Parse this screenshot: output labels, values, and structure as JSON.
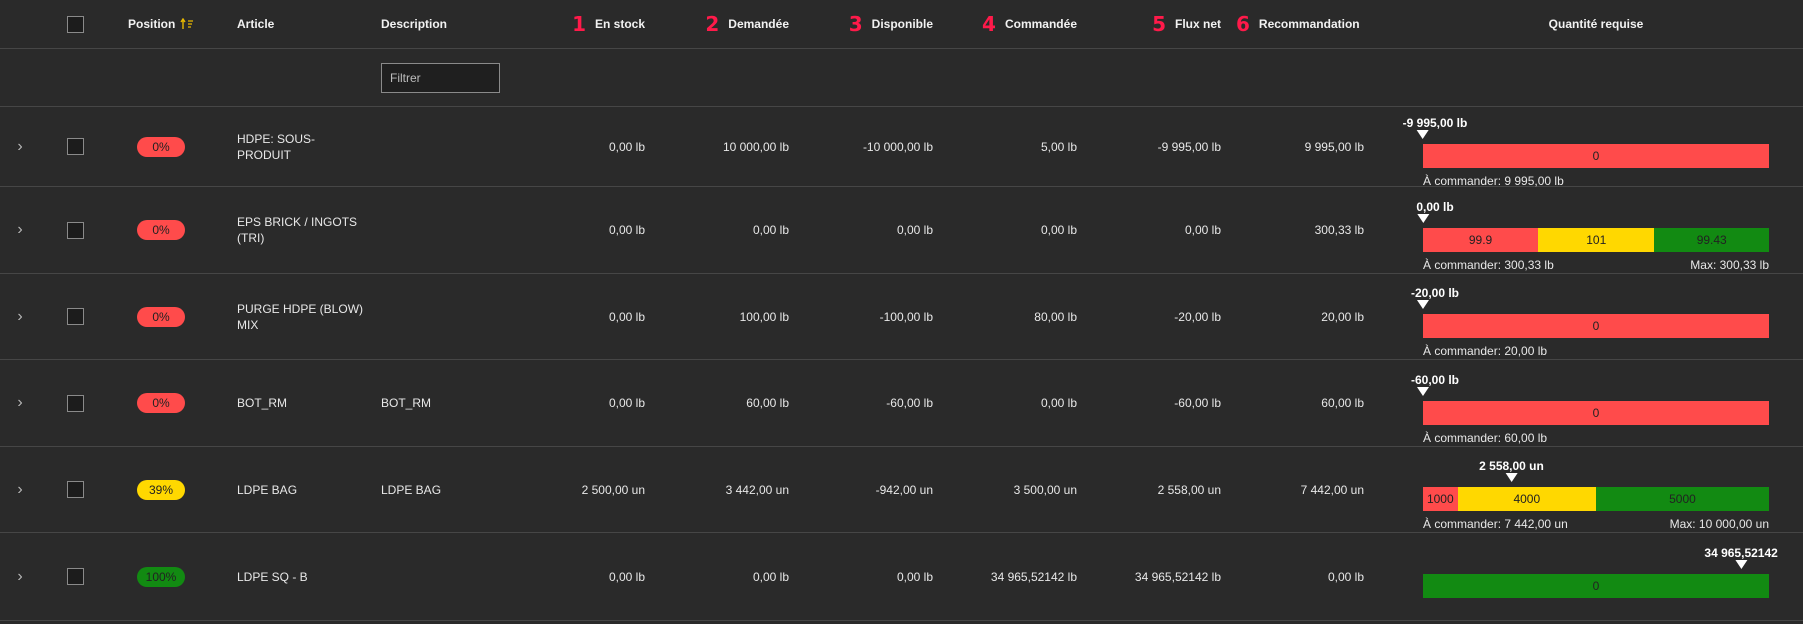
{
  "colors": {
    "red": "#ff4b4b",
    "yellow": "#ffd800",
    "green": "#128a12",
    "highlight_number": "#ff1a4a",
    "sort_icon": "#e8b800"
  },
  "header": {
    "position": "Position",
    "article": "Article",
    "description": "Description",
    "en_stock_num": "1",
    "en_stock": "En stock",
    "demandee_num": "2",
    "demandee": "Demandée",
    "disponible_num": "3",
    "disponible": "Disponible",
    "commandee_num": "4",
    "commandee": "Commandée",
    "flux_net_num": "5",
    "flux_net": "Flux net",
    "recommandation_num": "6",
    "recommandation": "Recommandation",
    "quantite_requise": "Quantité requise"
  },
  "filter": {
    "placeholder": "Filtrer"
  },
  "rows": [
    {
      "position": "0%",
      "position_value": 0,
      "badge_color": "#ff4b4b",
      "article": "HDPE: SOUS-PRODUIT",
      "description": "",
      "en_stock": "0,00 lb",
      "demandee": "10 000,00 lb",
      "disponible": "-10 000,00 lb",
      "commandee": "5,00 lb",
      "flux_net": "-9 995,00 lb",
      "recommandation": "9 995,00 lb",
      "marker_label": "-9 995,00 lb",
      "marker_fraction": 0,
      "segments": [
        {
          "label": "0",
          "color": "#ff4b4b",
          "fraction": 1
        }
      ],
      "to_order": "À commander: 9 995,00 lb",
      "max": ""
    },
    {
      "position": "0%",
      "position_value": 0,
      "badge_color": "#ff4b4b",
      "article": "EPS BRICK / INGOTS (TRI)",
      "description": "",
      "en_stock": "0,00 lb",
      "demandee": "0,00 lb",
      "disponible": "0,00 lb",
      "commandee": "0,00 lb",
      "flux_net": "0,00 lb",
      "recommandation": "300,33 lb",
      "marker_label": "0,00 lb",
      "marker_fraction": 0,
      "segments": [
        {
          "label": "99.9",
          "color": "#ff4b4b",
          "fraction": 0.3326
        },
        {
          "label": "101",
          "color": "#ffd800",
          "fraction": 0.3363
        },
        {
          "label": "99.43",
          "color": "#128a12",
          "fraction": 0.3311
        }
      ],
      "to_order": "À commander: 300,33 lb",
      "max": "Max: 300,33 lb"
    },
    {
      "position": "0%",
      "position_value": 0,
      "badge_color": "#ff4b4b",
      "article": "PURGE HDPE (BLOW) MIX",
      "description": "",
      "en_stock": "0,00 lb",
      "demandee": "100,00 lb",
      "disponible": "-100,00 lb",
      "commandee": "80,00 lb",
      "flux_net": "-20,00 lb",
      "recommandation": "20,00 lb",
      "marker_label": "-20,00 lb",
      "marker_fraction": 0,
      "segments": [
        {
          "label": "0",
          "color": "#ff4b4b",
          "fraction": 1
        }
      ],
      "to_order": "À commander: 20,00 lb",
      "max": ""
    },
    {
      "position": "0%",
      "position_value": 0,
      "badge_color": "#ff4b4b",
      "article": "BOT_RM",
      "description": "BOT_RM",
      "en_stock": "0,00 lb",
      "demandee": "60,00 lb",
      "disponible": "-60,00 lb",
      "commandee": "0,00 lb",
      "flux_net": "-60,00 lb",
      "recommandation": "60,00 lb",
      "marker_label": "-60,00 lb",
      "marker_fraction": 0,
      "segments": [
        {
          "label": "0",
          "color": "#ff4b4b",
          "fraction": 1
        }
      ],
      "to_order": "À commander: 60,00 lb",
      "max": ""
    },
    {
      "position": "39%",
      "position_value": 39,
      "badge_color": "#ffd800",
      "article": "LDPE BAG",
      "description": "LDPE BAG",
      "en_stock": "2 500,00 un",
      "demandee": "3 442,00 un",
      "disponible": "-942,00 un",
      "commandee": "3 500,00 un",
      "flux_net": "2 558,00 un",
      "recommandation": "7 442,00 un",
      "marker_label": "2 558,00 un",
      "marker_fraction": 0.2558,
      "segments": [
        {
          "label": "1000",
          "color": "#ff4b4b",
          "fraction": 0.1
        },
        {
          "label": "4000",
          "color": "#ffd800",
          "fraction": 0.4
        },
        {
          "label": "5000",
          "color": "#128a12",
          "fraction": 0.5
        }
      ],
      "to_order": "À commander: 7 442,00 un",
      "max": "Max: 10 000,00 un"
    },
    {
      "position": "100%",
      "position_value": 100,
      "badge_color": "#128a12",
      "article": "LDPE SQ - B",
      "description": "",
      "en_stock": "0,00 lb",
      "demandee": "0,00 lb",
      "disponible": "0,00 lb",
      "commandee": "34 965,52142 lb",
      "flux_net": "34 965,52142 lb",
      "recommandation": "0,00 lb",
      "marker_label": "34 965,52142",
      "marker_fraction": 1,
      "segments": [
        {
          "label": "0",
          "color": "#128a12",
          "fraction": 1
        }
      ],
      "to_order": "",
      "max": ""
    }
  ]
}
